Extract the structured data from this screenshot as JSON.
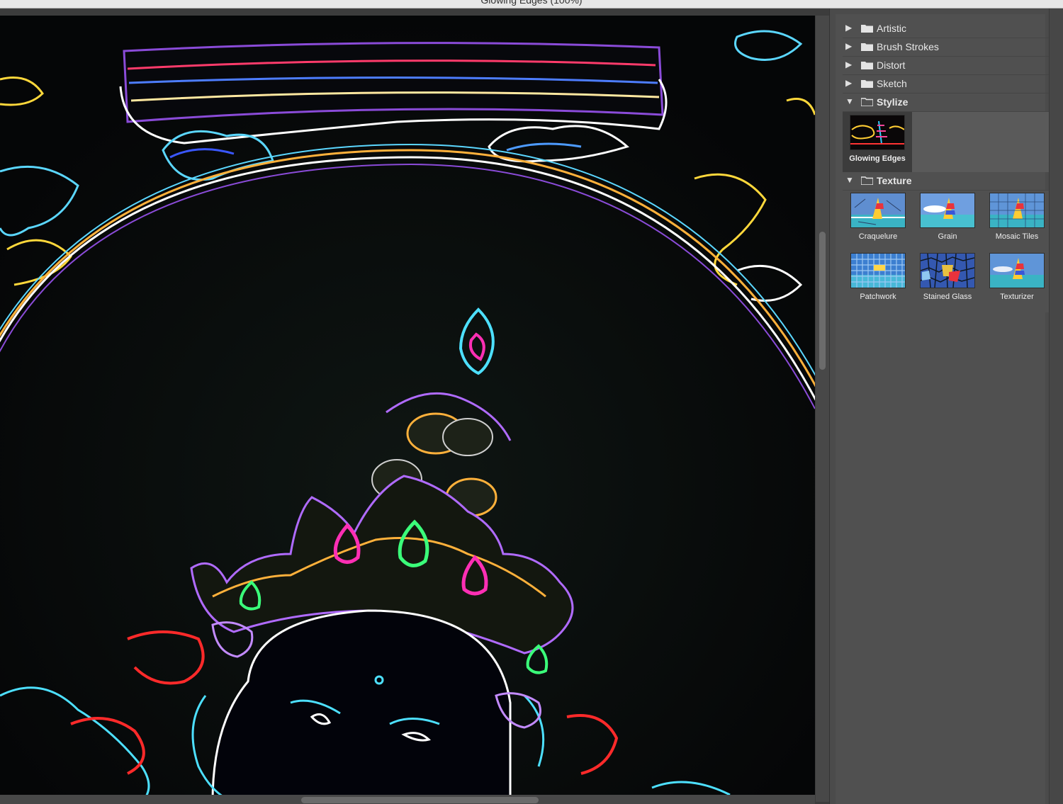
{
  "window": {
    "title": "Glowing Edges (100%)"
  },
  "categories": [
    {
      "label": "Artistic",
      "expanded": false
    },
    {
      "label": "Brush Strokes",
      "expanded": false
    },
    {
      "label": "Distort",
      "expanded": false
    },
    {
      "label": "Sketch",
      "expanded": false
    },
    {
      "label": "Stylize",
      "expanded": true,
      "filters": [
        {
          "label": "Glowing Edges",
          "selected": true
        }
      ]
    },
    {
      "label": "Texture",
      "expanded": true,
      "filters": [
        {
          "label": "Craquelure"
        },
        {
          "label": "Grain"
        },
        {
          "label": "Mosaic Tiles"
        },
        {
          "label": "Patchwork"
        },
        {
          "label": "Stained Glass"
        },
        {
          "label": "Texturizer"
        }
      ]
    }
  ],
  "icons": {
    "expanded": "triangle-down-icon",
    "collapsed": "triangle-right-icon",
    "folder": "folder-icon"
  },
  "colors": {
    "panel_bg": "#505050",
    "selected_thumb": "#3c3c3c",
    "preview_bg": "#040506"
  }
}
